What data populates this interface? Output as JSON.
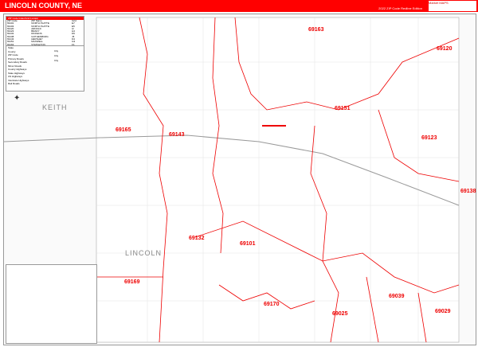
{
  "header": {
    "title": "LINCOLN COUNTY, NE",
    "edition": "2022 ZIP Code Redline Edition",
    "logo": "Market MAPS"
  },
  "index": {
    "title": "ZIP Code Index/Grid Locator",
    "footer": "ZIP Codes Inside Map",
    "columns": [
      "ZIP Code",
      "ZIP Name",
      "Grid"
    ],
    "rows": [
      [
        "69101",
        "NORTH PLATTE",
        "E7"
      ],
      [
        "69103",
        "NORTH PLATTE",
        "E5"
      ],
      [
        "69120",
        "ARNOLD",
        "I2"
      ],
      [
        "69123",
        "BRADY",
        "H4"
      ],
      [
        "69132",
        "DICKENS",
        "D6"
      ],
      [
        "69138",
        "GOTHENBURG",
        "J5"
      ],
      [
        "69143",
        "HERSHEY",
        "D4"
      ],
      [
        "69151",
        "MAXWELL",
        "G3"
      ],
      [
        "69163",
        "STAPLETON",
        "F1"
      ],
      [
        "69165",
        "SUTHERLAND",
        "C4"
      ],
      [
        "69169",
        "WALLACE",
        "B7"
      ],
      [
        "69170",
        "WELLFLEET",
        "E8"
      ],
      [
        "69025",
        "CURTIS",
        "G9"
      ],
      [
        "69029",
        "FARNAM",
        "I9"
      ],
      [
        "69039",
        "MOOREFIELD",
        "H8"
      ]
    ]
  },
  "legend": {
    "items": [
      "State",
      "County",
      "ZIP Code",
      "Primary Roads",
      "Secondary Roads",
      "Minor Roads",
      "County Highways",
      "State Highways",
      "US Highways",
      "Interstate Highways",
      "Rail Roads"
    ],
    "cities": [
      "City",
      "City",
      "City"
    ]
  },
  "map": {
    "counties": [
      "KEITH",
      "LINCOLN"
    ],
    "zips": [
      {
        "code": "69163"
      },
      {
        "code": "69120"
      },
      {
        "code": "69151"
      },
      {
        "code": "69165"
      },
      {
        "code": "69143"
      },
      {
        "code": "69123"
      },
      {
        "code": "69138"
      },
      {
        "code": "69132"
      },
      {
        "code": "69101"
      },
      {
        "code": "69169"
      },
      {
        "code": "69170"
      },
      {
        "code": "69039"
      },
      {
        "code": "69025"
      },
      {
        "code": "69029"
      }
    ]
  },
  "colors": {
    "accent": "#ff0000",
    "boundary": "#e00000"
  }
}
